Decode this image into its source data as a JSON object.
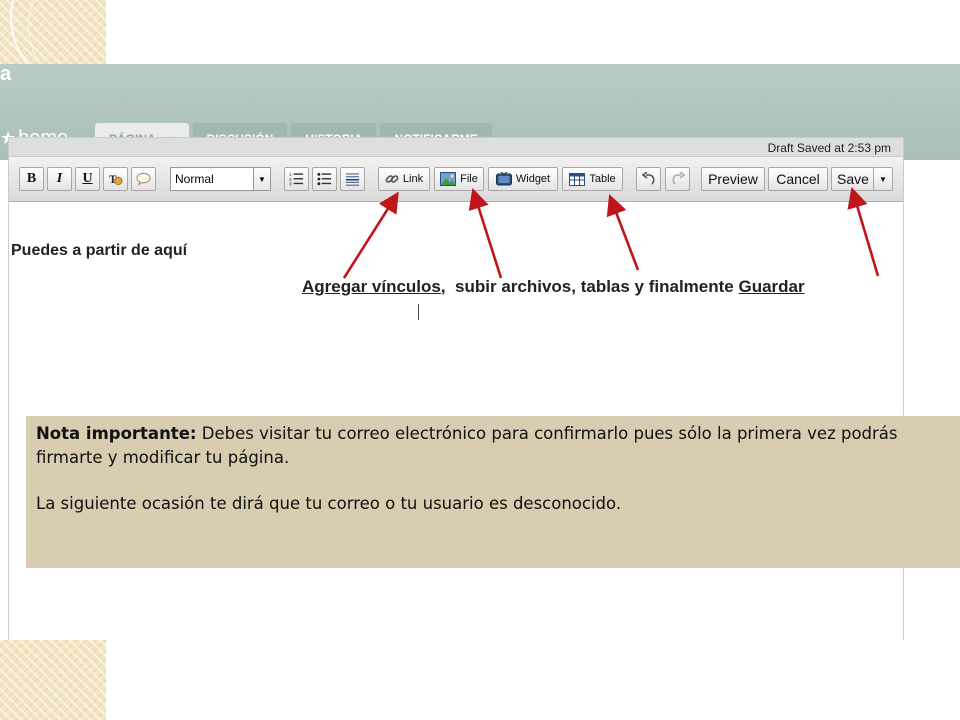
{
  "site": {
    "title_fragment": "a",
    "home_icon": "star-icon",
    "home_label": "home"
  },
  "tabs": [
    {
      "label": "PÁGINA",
      "active": true
    },
    {
      "label": "DISCUSIÓN",
      "active": false
    },
    {
      "label": "HISTORIA",
      "active": false
    },
    {
      "label": "NOTIFICARME",
      "active": false
    }
  ],
  "editor": {
    "draft_status": "Draft Saved at 2:53 pm",
    "toolbar": {
      "bold": "B",
      "italic": "I",
      "underline": "U",
      "format_value": "Normal",
      "link": "Link",
      "file": "File",
      "widget": "Widget",
      "table": "Table",
      "preview": "Preview",
      "cancel": "Cancel",
      "save": "Save"
    },
    "content": {
      "intro": "Puedes a partir de aquí",
      "annotation_part1": "Agregar vínculos",
      "annotation_part2": ",  subir archivos, tablas y finalmente ",
      "annotation_part3": "Guardar"
    }
  },
  "note": {
    "label": "Nota importante:",
    "text1": " Debes visitar tu correo electrónico para confirmarlo pues sólo la primera vez podrás firmarte y modificar tu página.",
    "text2": "La siguiente ocasión te dirá que tu correo o tu usuario es desconocido."
  },
  "colors": {
    "arrow": "#c0151b",
    "note_background": "#d8cdb0",
    "site_band": "#b3c7bf"
  }
}
